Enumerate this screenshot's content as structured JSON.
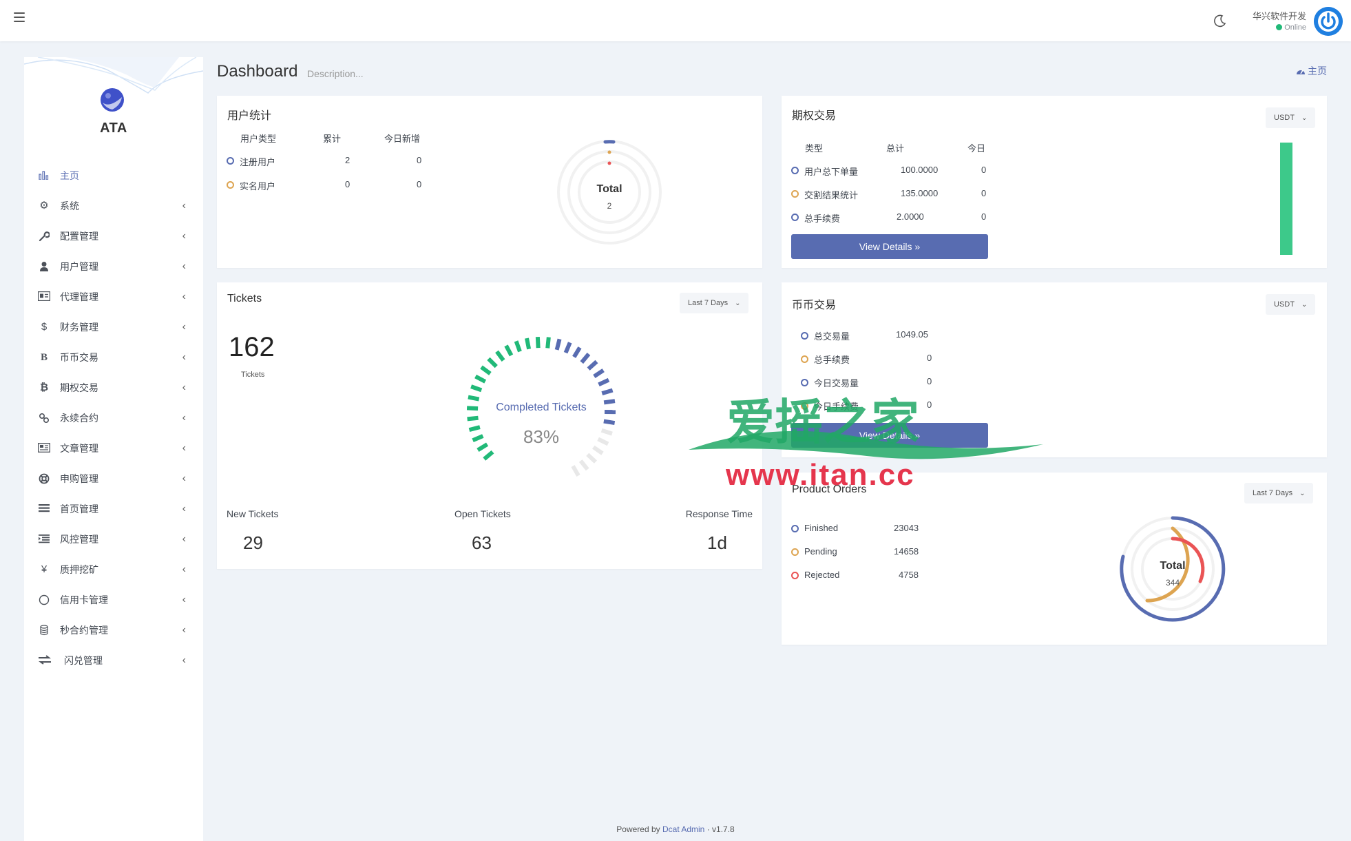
{
  "header": {
    "user_name": "华兴软件开发",
    "user_status": "Online"
  },
  "sidebar": {
    "brand": "ATA",
    "items": [
      {
        "label": "主页",
        "icon": "bar-chart-icon"
      },
      {
        "label": "系统",
        "icon": "gear-icon"
      },
      {
        "label": "配置管理",
        "icon": "wrench-icon"
      },
      {
        "label": "用户管理",
        "icon": "user-icon"
      },
      {
        "label": "代理管理",
        "icon": "id-card-icon"
      },
      {
        "label": "财务管理",
        "icon": "dollar-icon"
      },
      {
        "label": "币币交易",
        "icon": "bitcoin-icon"
      },
      {
        "label": "期权交易",
        "icon": "bitcoin-icon"
      },
      {
        "label": "永续合约",
        "icon": "link-icon"
      },
      {
        "label": "文章管理",
        "icon": "newspaper-icon"
      },
      {
        "label": "申购管理",
        "icon": "lifebuoy-icon"
      },
      {
        "label": "首页管理",
        "icon": "list-icon"
      },
      {
        "label": "风控管理",
        "icon": "indent-icon"
      },
      {
        "label": "质押挖矿",
        "icon": "yen-icon"
      },
      {
        "label": "信用卡管理",
        "icon": "circle-icon"
      },
      {
        "label": "秒合约管理",
        "icon": "coins-icon"
      },
      {
        "label": "闪兑管理",
        "icon": "exchange-icon"
      }
    ]
  },
  "page": {
    "title": "Dashboard",
    "description": "Description...",
    "breadcrumb": "主页"
  },
  "user_stats": {
    "title": "用户统计",
    "headers": [
      "用户类型",
      "累计",
      "今日新增"
    ],
    "rows": [
      {
        "type": "注册用户",
        "total": "2",
        "today": "0"
      },
      {
        "type": "实名用户",
        "total": "0",
        "today": "0"
      }
    ],
    "donut_label": "Total",
    "donut_value": "2"
  },
  "options_trade": {
    "title": "期权交易",
    "currency": "USDT",
    "headers": [
      "类型",
      "总计",
      "今日"
    ],
    "rows": [
      {
        "type": "用户总下单量",
        "total": "100.0000",
        "today": "0"
      },
      {
        "type": "交割结果统计",
        "total": "135.0000",
        "today": "0"
      },
      {
        "type": "总手续费",
        "total": "2.0000",
        "today": "0"
      }
    ],
    "button": "View Details »"
  },
  "tickets": {
    "title": "Tickets",
    "range": "Last 7 Days",
    "count": "162",
    "count_label": "Tickets",
    "gauge_label": "Completed Tickets",
    "gauge_value": "83%",
    "gauge_fraction": 0.83,
    "stats": [
      {
        "label": "New Tickets",
        "value": "29"
      },
      {
        "label": "Open Tickets",
        "value": "63"
      },
      {
        "label": "Response Time",
        "value": "1d"
      }
    ]
  },
  "coin_trade": {
    "title": "币币交易",
    "currency": "USDT",
    "rows": [
      {
        "type": "总交易量",
        "value": "1049.05"
      },
      {
        "type": "总手续费",
        "value": "0"
      },
      {
        "type": "今日交易量",
        "value": "0"
      },
      {
        "type": "今日手续费",
        "value": "0"
      }
    ],
    "button": "View Details »"
  },
  "product_orders": {
    "title": "Product Orders",
    "range": "Last 7 Days",
    "rows": [
      {
        "label": "Finished",
        "value": "23043"
      },
      {
        "label": "Pending",
        "value": "14658"
      },
      {
        "label": "Rejected",
        "value": "4758"
      }
    ],
    "donut_label": "Total",
    "donut_value": "344"
  },
  "watermark": {
    "logo_text": "爱摇之家",
    "url": "www.itan.cc"
  },
  "footer": {
    "powered": "Powered by",
    "link": "Dcat Admin",
    "sep": "·",
    "version": "v1.7.8"
  },
  "colors": {
    "primary": "#586cb1",
    "success": "#21b978",
    "warning": "#dda451",
    "danger": "#ea5455"
  }
}
